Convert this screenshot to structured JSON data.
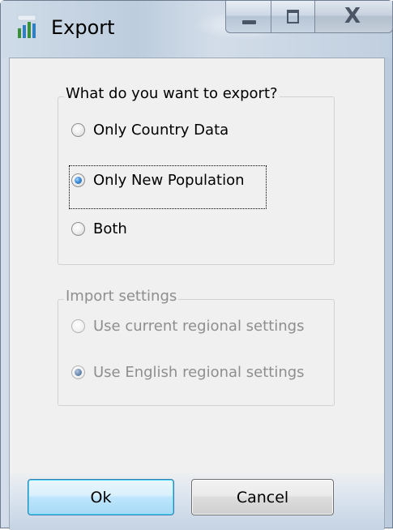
{
  "window": {
    "title": "Export",
    "icon_name": "chart-bars-icon",
    "controls": {
      "minimize_icon": "minimize-icon",
      "maximize_icon": "maximize-icon",
      "close_icon": "close-icon",
      "close_glyph": "X"
    }
  },
  "export_group": {
    "legend": "What do you want to export?",
    "options": [
      {
        "label": "Only Country Data",
        "checked": false
      },
      {
        "label": "Only New Population",
        "checked": true,
        "focused": true
      },
      {
        "label": "Both",
        "checked": false
      }
    ]
  },
  "import_group": {
    "legend": "Import settings",
    "disabled": true,
    "options": [
      {
        "label": "Use current regional settings",
        "checked": false
      },
      {
        "label": "Use English regional settings",
        "checked": true
      }
    ]
  },
  "buttons": {
    "ok_label": "Ok",
    "cancel_label": "Cancel"
  },
  "colors": {
    "accent": "#3c7fb1",
    "disabled_text": "#8e8e8e",
    "client_bg": "#f0f0f0"
  }
}
